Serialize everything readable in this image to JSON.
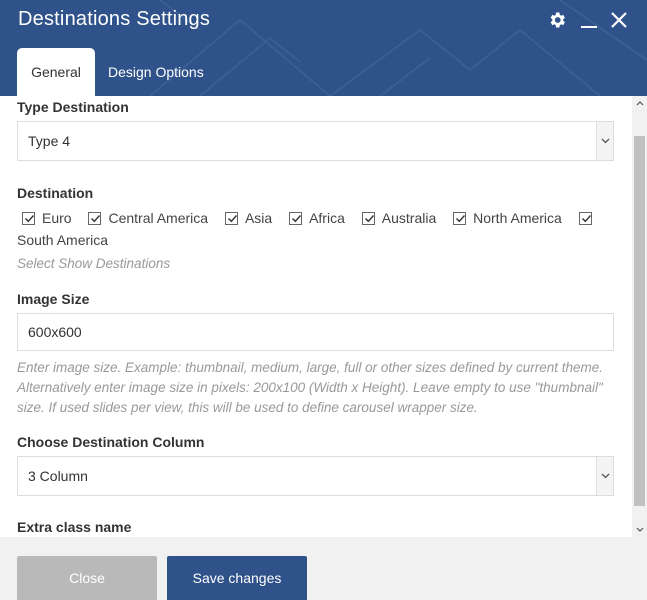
{
  "header": {
    "title": "Destinations Settings",
    "icons": [
      "gear-icon",
      "minimize-icon",
      "close-icon"
    ]
  },
  "tabs": [
    {
      "label": "General",
      "active": true
    },
    {
      "label": "Design Options",
      "active": false
    }
  ],
  "fields": {
    "type_destination": {
      "label": "Type Destination",
      "value": "Type 4"
    },
    "destination": {
      "label": "Destination",
      "options": [
        {
          "label": "Euro",
          "checked": true
        },
        {
          "label": "Central America",
          "checked": true
        },
        {
          "label": "Asia",
          "checked": true
        },
        {
          "label": "Africa",
          "checked": true
        },
        {
          "label": "Australia",
          "checked": true
        },
        {
          "label": "North America",
          "checked": true
        },
        {
          "label": "South America",
          "checked": true
        }
      ],
      "help": "Select Show Destinations"
    },
    "image_size": {
      "label": "Image Size",
      "value": "600x600",
      "help": "Enter image size. Example: thumbnail, medium, large, full or other sizes defined by current theme. Alternatively enter image size in pixels: 200x100 (Width x Height). Leave empty to use \"thumbnail\" size. If used slides per view, this will be used to define carousel wrapper size."
    },
    "destination_column": {
      "label": "Choose Destination Column",
      "value": "3 Column"
    },
    "extra_class": {
      "label": "Extra class name"
    }
  },
  "footer": {
    "close_label": "Close",
    "save_label": "Save changes"
  },
  "colors": {
    "header_bg": "#2e5289",
    "save_bg": "#2e5289",
    "close_bg": "#b9b9b9"
  }
}
